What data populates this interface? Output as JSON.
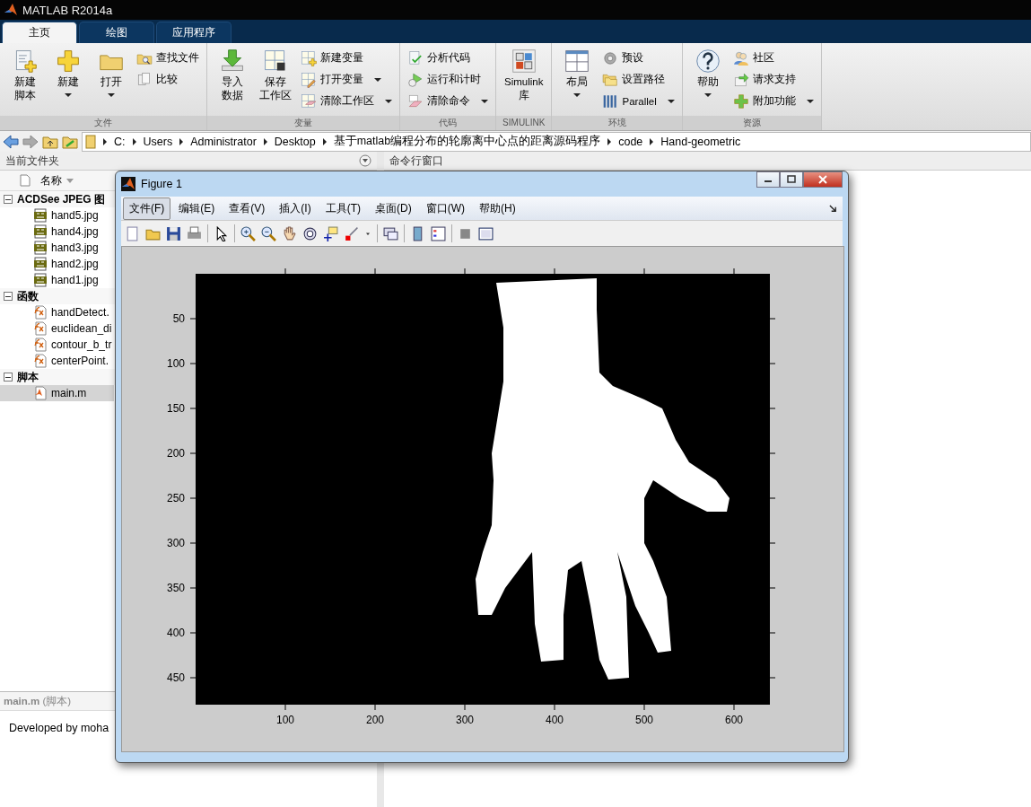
{
  "app": {
    "title": "MATLAB R2014a"
  },
  "tabs": [
    {
      "label": "主页",
      "selected": true
    },
    {
      "label": "绘图",
      "selected": false
    },
    {
      "label": "应用程序",
      "selected": false
    }
  ],
  "ribbon": [
    {
      "label": "文件",
      "items": [
        {
          "kind": "large",
          "lines": [
            "新建",
            "脚本"
          ],
          "dropdown": false
        },
        {
          "kind": "large",
          "lines": [
            "新建"
          ],
          "dropdown": true
        },
        {
          "kind": "large",
          "lines": [
            "打开"
          ],
          "dropdown": true
        },
        {
          "kind": "small",
          "label": "查找文件",
          "dropdown": false
        },
        {
          "kind": "small",
          "label": "比较",
          "dropdown": false
        }
      ]
    },
    {
      "label": "变量",
      "items": [
        {
          "kind": "large",
          "lines": [
            "导入",
            "数据"
          ],
          "dropdown": false
        },
        {
          "kind": "large",
          "lines": [
            "保存",
            "工作区"
          ],
          "dropdown": false
        },
        {
          "kind": "small",
          "label": "新建变量",
          "dropdown": false
        },
        {
          "kind": "small",
          "label": "打开变量",
          "dropdown": true
        },
        {
          "kind": "small",
          "label": "清除工作区",
          "dropdown": true
        }
      ]
    },
    {
      "label": "代码",
      "items": [
        {
          "kind": "small",
          "label": "分析代码",
          "dropdown": false
        },
        {
          "kind": "small",
          "label": "运行和计时",
          "dropdown": false
        },
        {
          "kind": "small",
          "label": "清除命令",
          "dropdown": true
        }
      ]
    },
    {
      "label": "SIMULINK",
      "items": [
        {
          "kind": "large",
          "lines": [
            "Simulink",
            "库"
          ],
          "dropdown": false
        }
      ]
    },
    {
      "label": "环境",
      "items": [
        {
          "kind": "large",
          "lines": [
            "布局"
          ],
          "dropdown": true
        },
        {
          "kind": "small",
          "label": "预设",
          "dropdown": false
        },
        {
          "kind": "small",
          "label": "设置路径",
          "dropdown": false
        },
        {
          "kind": "small",
          "label": "Parallel",
          "dropdown": true
        }
      ]
    },
    {
      "label": "资源",
      "items": [
        {
          "kind": "large",
          "lines": [
            "帮助"
          ],
          "dropdown": true
        },
        {
          "kind": "small",
          "label": "社区",
          "dropdown": false
        },
        {
          "kind": "small",
          "label": "请求支持",
          "dropdown": false
        },
        {
          "kind": "small",
          "label": "附加功能",
          "dropdown": true
        }
      ]
    }
  ],
  "path_bar": {
    "crumbs": [
      "C:",
      "Users",
      "Administrator",
      "Desktop",
      "基于matlab编程分布的轮廓离中心点的距离源码程序",
      "code",
      "Hand-geometric"
    ]
  },
  "current_folder": {
    "title": "当前文件夹",
    "column": "名称",
    "groups": [
      {
        "label": "ACDSee JPEG 图",
        "expanded": true,
        "children": [
          {
            "label": "hand5.jpg",
            "selected": false
          },
          {
            "label": "hand4.jpg",
            "selected": false
          },
          {
            "label": "hand3.jpg",
            "selected": false
          },
          {
            "label": "hand2.jpg",
            "selected": false
          },
          {
            "label": "hand1.jpg",
            "selected": false
          }
        ]
      },
      {
        "label": "函数",
        "expanded": true,
        "children": [
          {
            "label": "handDetect.",
            "selected": false
          },
          {
            "label": "euclidean_di",
            "selected": false
          },
          {
            "label": "contour_b_tr",
            "selected": false
          },
          {
            "label": "centerPoint.",
            "selected": false
          }
        ]
      },
      {
        "label": "脚本",
        "expanded": true,
        "children": [
          {
            "label": "main.m",
            "selected": true
          }
        ]
      }
    ]
  },
  "details": {
    "title": "**main.m** (脚本)",
    "text": "Developed by moha"
  },
  "command_window": {
    "title": "命令行窗口"
  },
  "figure": {
    "title": "Figure 1",
    "menu": [
      {
        "label": "文件(F)",
        "selected": true
      },
      {
        "label": "编辑(E)",
        "selected": false
      },
      {
        "label": "查看(V)",
        "selected": false
      },
      {
        "label": "插入(I)",
        "selected": false
      },
      {
        "label": "工具(T)",
        "selected": false
      },
      {
        "label": "桌面(D)",
        "selected": false
      },
      {
        "label": "窗口(W)",
        "selected": false
      },
      {
        "label": "帮助(H)",
        "selected": false
      }
    ],
    "axes": {
      "x_ticks": [
        "100",
        "200",
        "300",
        "400",
        "500",
        "600"
      ],
      "y_ticks": [
        "50",
        "100",
        "150",
        "200",
        "250",
        "300",
        "350",
        "400",
        "450"
      ]
    }
  }
}
